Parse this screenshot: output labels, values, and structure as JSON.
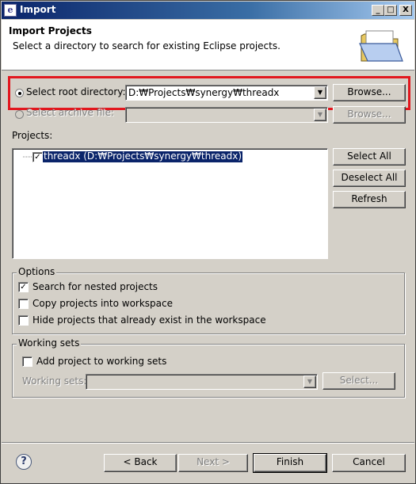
{
  "window": {
    "title": "Import",
    "app_icon_glyph": "e",
    "minimize_glyph": "_",
    "maximize_glyph": "□",
    "close_glyph": "X"
  },
  "header": {
    "title": "Import Projects",
    "description": "Select a directory to search for existing Eclipse projects."
  },
  "source": {
    "root_dir_label": "Select root directory:",
    "root_dir_value": "D:₩Projects₩synergy₩threadx",
    "archive_label": "Select archive file:",
    "archive_value": "",
    "browse_label": "Browse...",
    "browse2_label": "Browse...",
    "combo_arrow": "▼"
  },
  "projects": {
    "label": "Projects:",
    "items": [
      {
        "label": "threadx (D:₩Projects₩synergy₩threadx)",
        "checked": true
      }
    ],
    "checkmark": "✓",
    "select_all": "Select All",
    "deselect_all": "Deselect All",
    "refresh": "Refresh"
  },
  "options": {
    "title": "Options",
    "search_nested": "Search for nested projects",
    "copy_into_workspace": "Copy projects into workspace",
    "hide_existing": "Hide projects that already exist in the workspace",
    "checkmark": "✓"
  },
  "working_sets": {
    "title": "Working sets",
    "add_label": "Add project to working sets",
    "sets_label": "Working sets:",
    "select_button": "Select..."
  },
  "footer": {
    "help_glyph": "?",
    "back": "< Back",
    "next": "Next >",
    "finish": "Finish",
    "cancel": "Cancel"
  },
  "colors": {
    "highlight_box": "#e2171e",
    "selection": "#0a246a",
    "title_bar": "#0a246a"
  }
}
